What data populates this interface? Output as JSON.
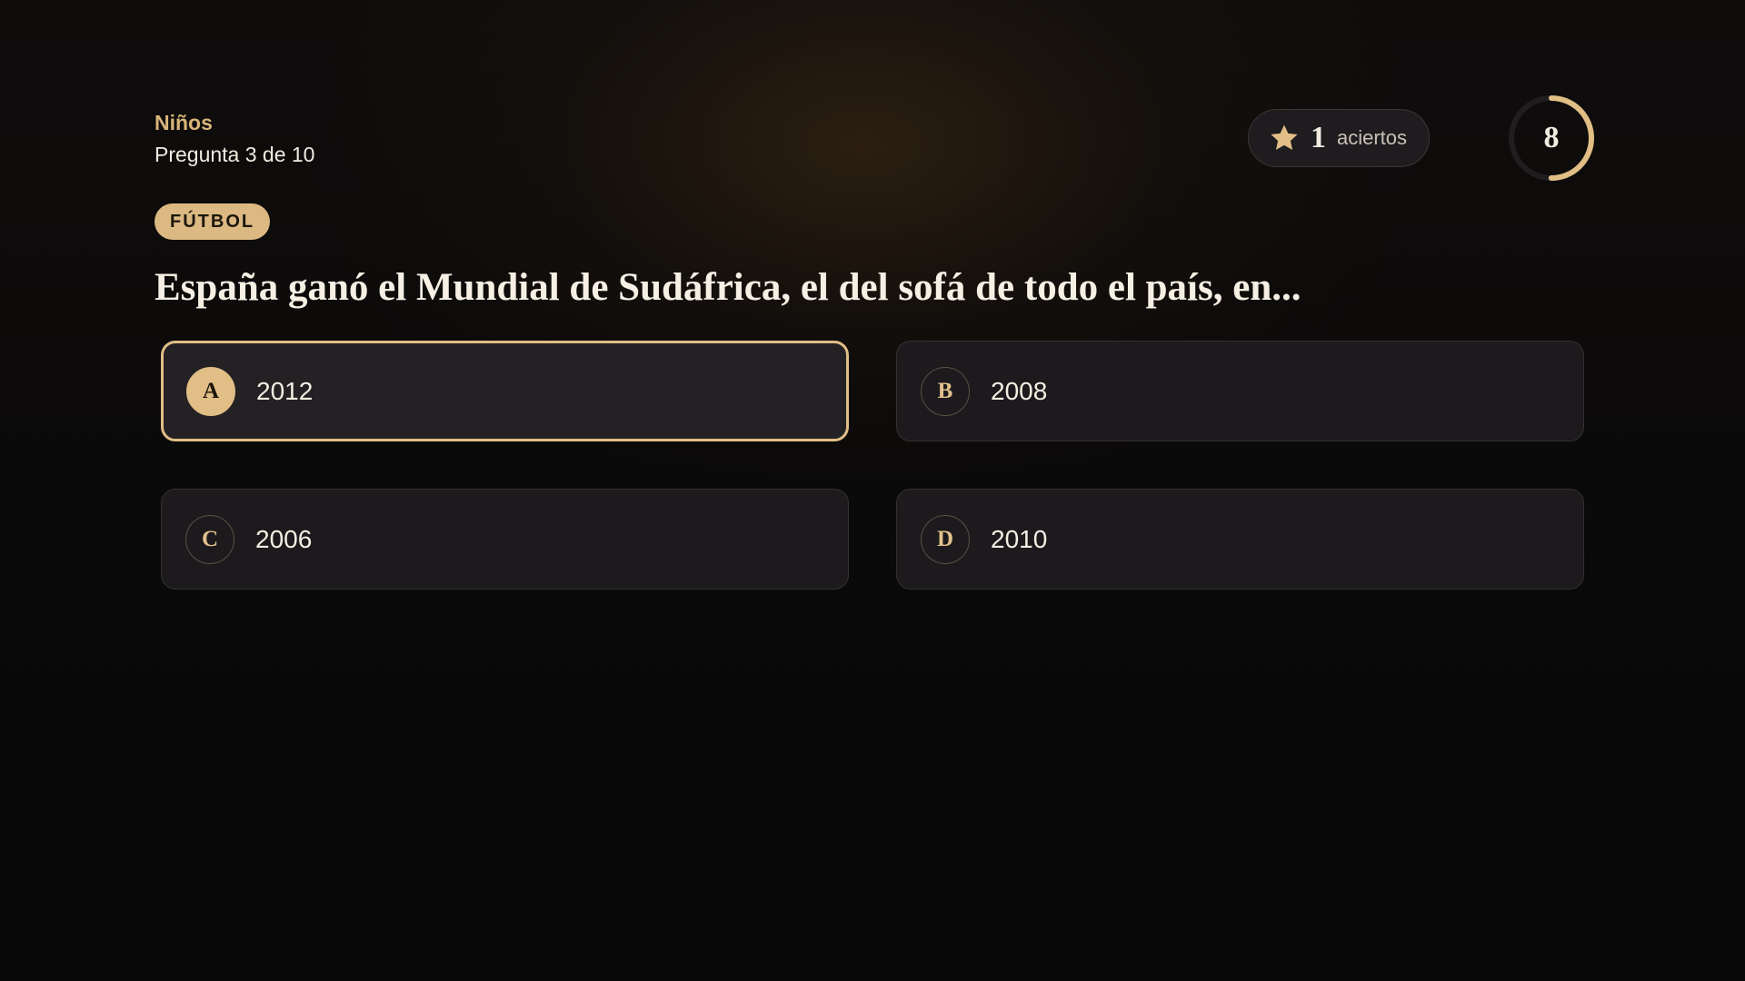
{
  "header": {
    "category": "Niños",
    "progress": "Pregunta 3 de 10"
  },
  "score": {
    "icon": "star-icon",
    "count": "1",
    "label": "aciertos"
  },
  "timer": {
    "seconds": "8",
    "remaining_fraction": 0.5
  },
  "topic": "FÚTBOL",
  "question": "España ganó el Mundial de Sudáfrica, el del sofá de todo el país, en...",
  "answers": [
    {
      "letter": "A",
      "text": "2012",
      "selected": true
    },
    {
      "letter": "B",
      "text": "2008",
      "selected": false
    },
    {
      "letter": "C",
      "text": "2006",
      "selected": false
    },
    {
      "letter": "D",
      "text": "2010",
      "selected": false
    }
  ],
  "colors": {
    "accent": "#e0be86",
    "background": "#0b0a0a",
    "card": "#1c1a1d"
  }
}
